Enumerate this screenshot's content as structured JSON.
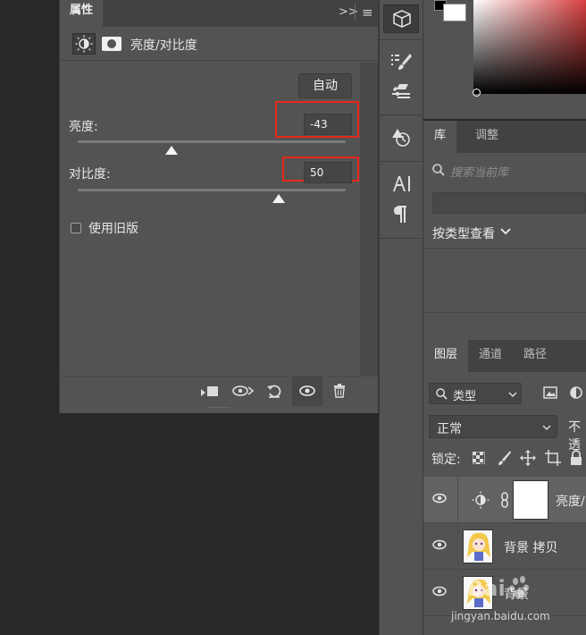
{
  "properties": {
    "tab": "属性",
    "expand_glyph": ">>",
    "menu_glyph": "≡",
    "title": "亮度/对比度",
    "auto_label": "自动",
    "brightness_label": "亮度:",
    "brightness_value": "-43",
    "brightness_level": 0.35,
    "contrast_label": "对比度:",
    "contrast_value": "50",
    "contrast_level": 0.75,
    "legacy_label": "使用旧版"
  },
  "library": {
    "tabs": [
      "库",
      "调整"
    ],
    "search_placeholder": "搜索当前库",
    "view_by": "按类型查看"
  },
  "layers": {
    "tabs": [
      "图层",
      "通道",
      "路径"
    ],
    "filter": "类型",
    "blend_mode": "正常",
    "opacity_label": "不透",
    "lock_label": "锁定:",
    "rows": [
      {
        "name": "亮度/"
      },
      {
        "name": "背景 拷贝"
      },
      {
        "name": "背景"
      }
    ]
  },
  "watermark": "jingyan.baidu.com",
  "colors": {
    "highlight": "#e8281c"
  }
}
